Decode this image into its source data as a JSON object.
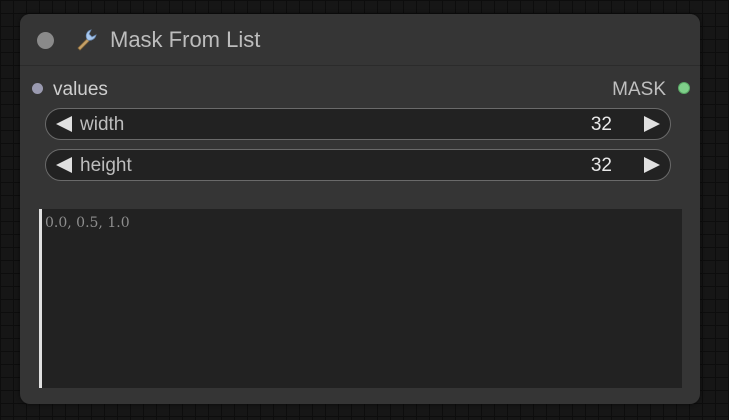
{
  "node": {
    "title": "Mask From List",
    "icon": "wrench-icon"
  },
  "slots": {
    "input": {
      "label": "values"
    },
    "output": {
      "label": "MASK"
    }
  },
  "widgets": {
    "width": {
      "label": "width",
      "value": "32"
    },
    "height": {
      "label": "height",
      "value": "32"
    }
  },
  "textarea": {
    "value": "",
    "placeholder": "0.0, 0.5, 1.0"
  },
  "colors": {
    "background": "#161616",
    "node": "#353535",
    "widget": "#222222",
    "output_slot": "#7fd08a",
    "input_slot": "#9a9ab0"
  }
}
